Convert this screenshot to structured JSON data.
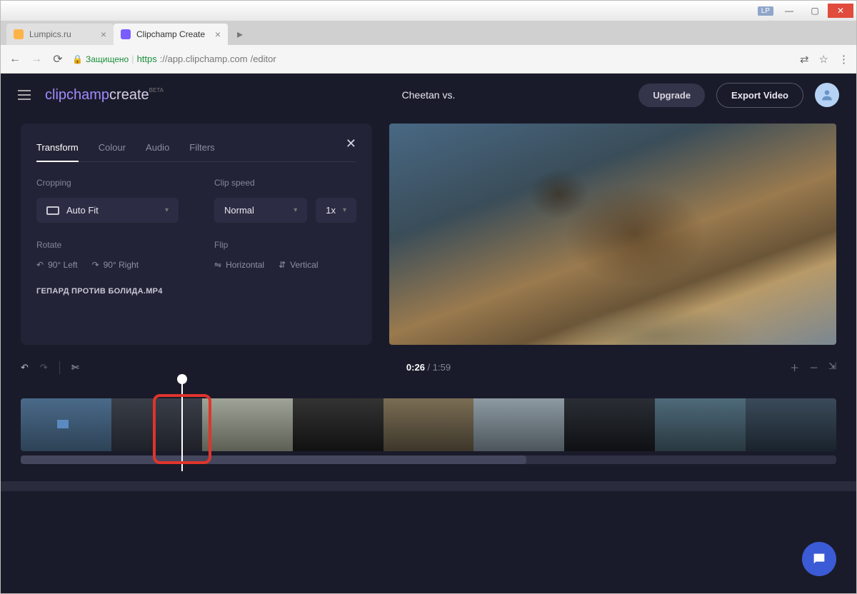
{
  "window": {
    "user_badge": "LP"
  },
  "browser": {
    "tabs": [
      {
        "title": "Lumpics.ru",
        "active": false
      },
      {
        "title": "Clipchamp Create",
        "active": true
      }
    ],
    "security_label": "Защищено",
    "url_proto": "https",
    "url_host": "://app.clipchamp.com",
    "url_path": "/editor"
  },
  "app": {
    "logo_a": "clipchamp",
    "logo_b": "create",
    "logo_badge": "BETA",
    "project_title": "Cheetan vs.",
    "btn_upgrade": "Upgrade",
    "btn_export": "Export Video"
  },
  "panel": {
    "tabs": {
      "transform": "Transform",
      "colour": "Colour",
      "audio": "Audio",
      "filters": "Filters"
    },
    "cropping_label": "Cropping",
    "cropping_value": "Auto Fit",
    "clipspeed_label": "Clip speed",
    "speed_value": "Normal",
    "speed_mult": "1x",
    "rotate_label": "Rotate",
    "rotate_left": "90° Left",
    "rotate_right": "90° Right",
    "flip_label": "Flip",
    "flip_h": "Horizontal",
    "flip_v": "Vertical",
    "clip_filename": "ГЕПАРД ПРОТИВ БОЛИДА.MP4"
  },
  "timeline": {
    "current": "0:26",
    "duration": "1:59",
    "sep": " / "
  }
}
